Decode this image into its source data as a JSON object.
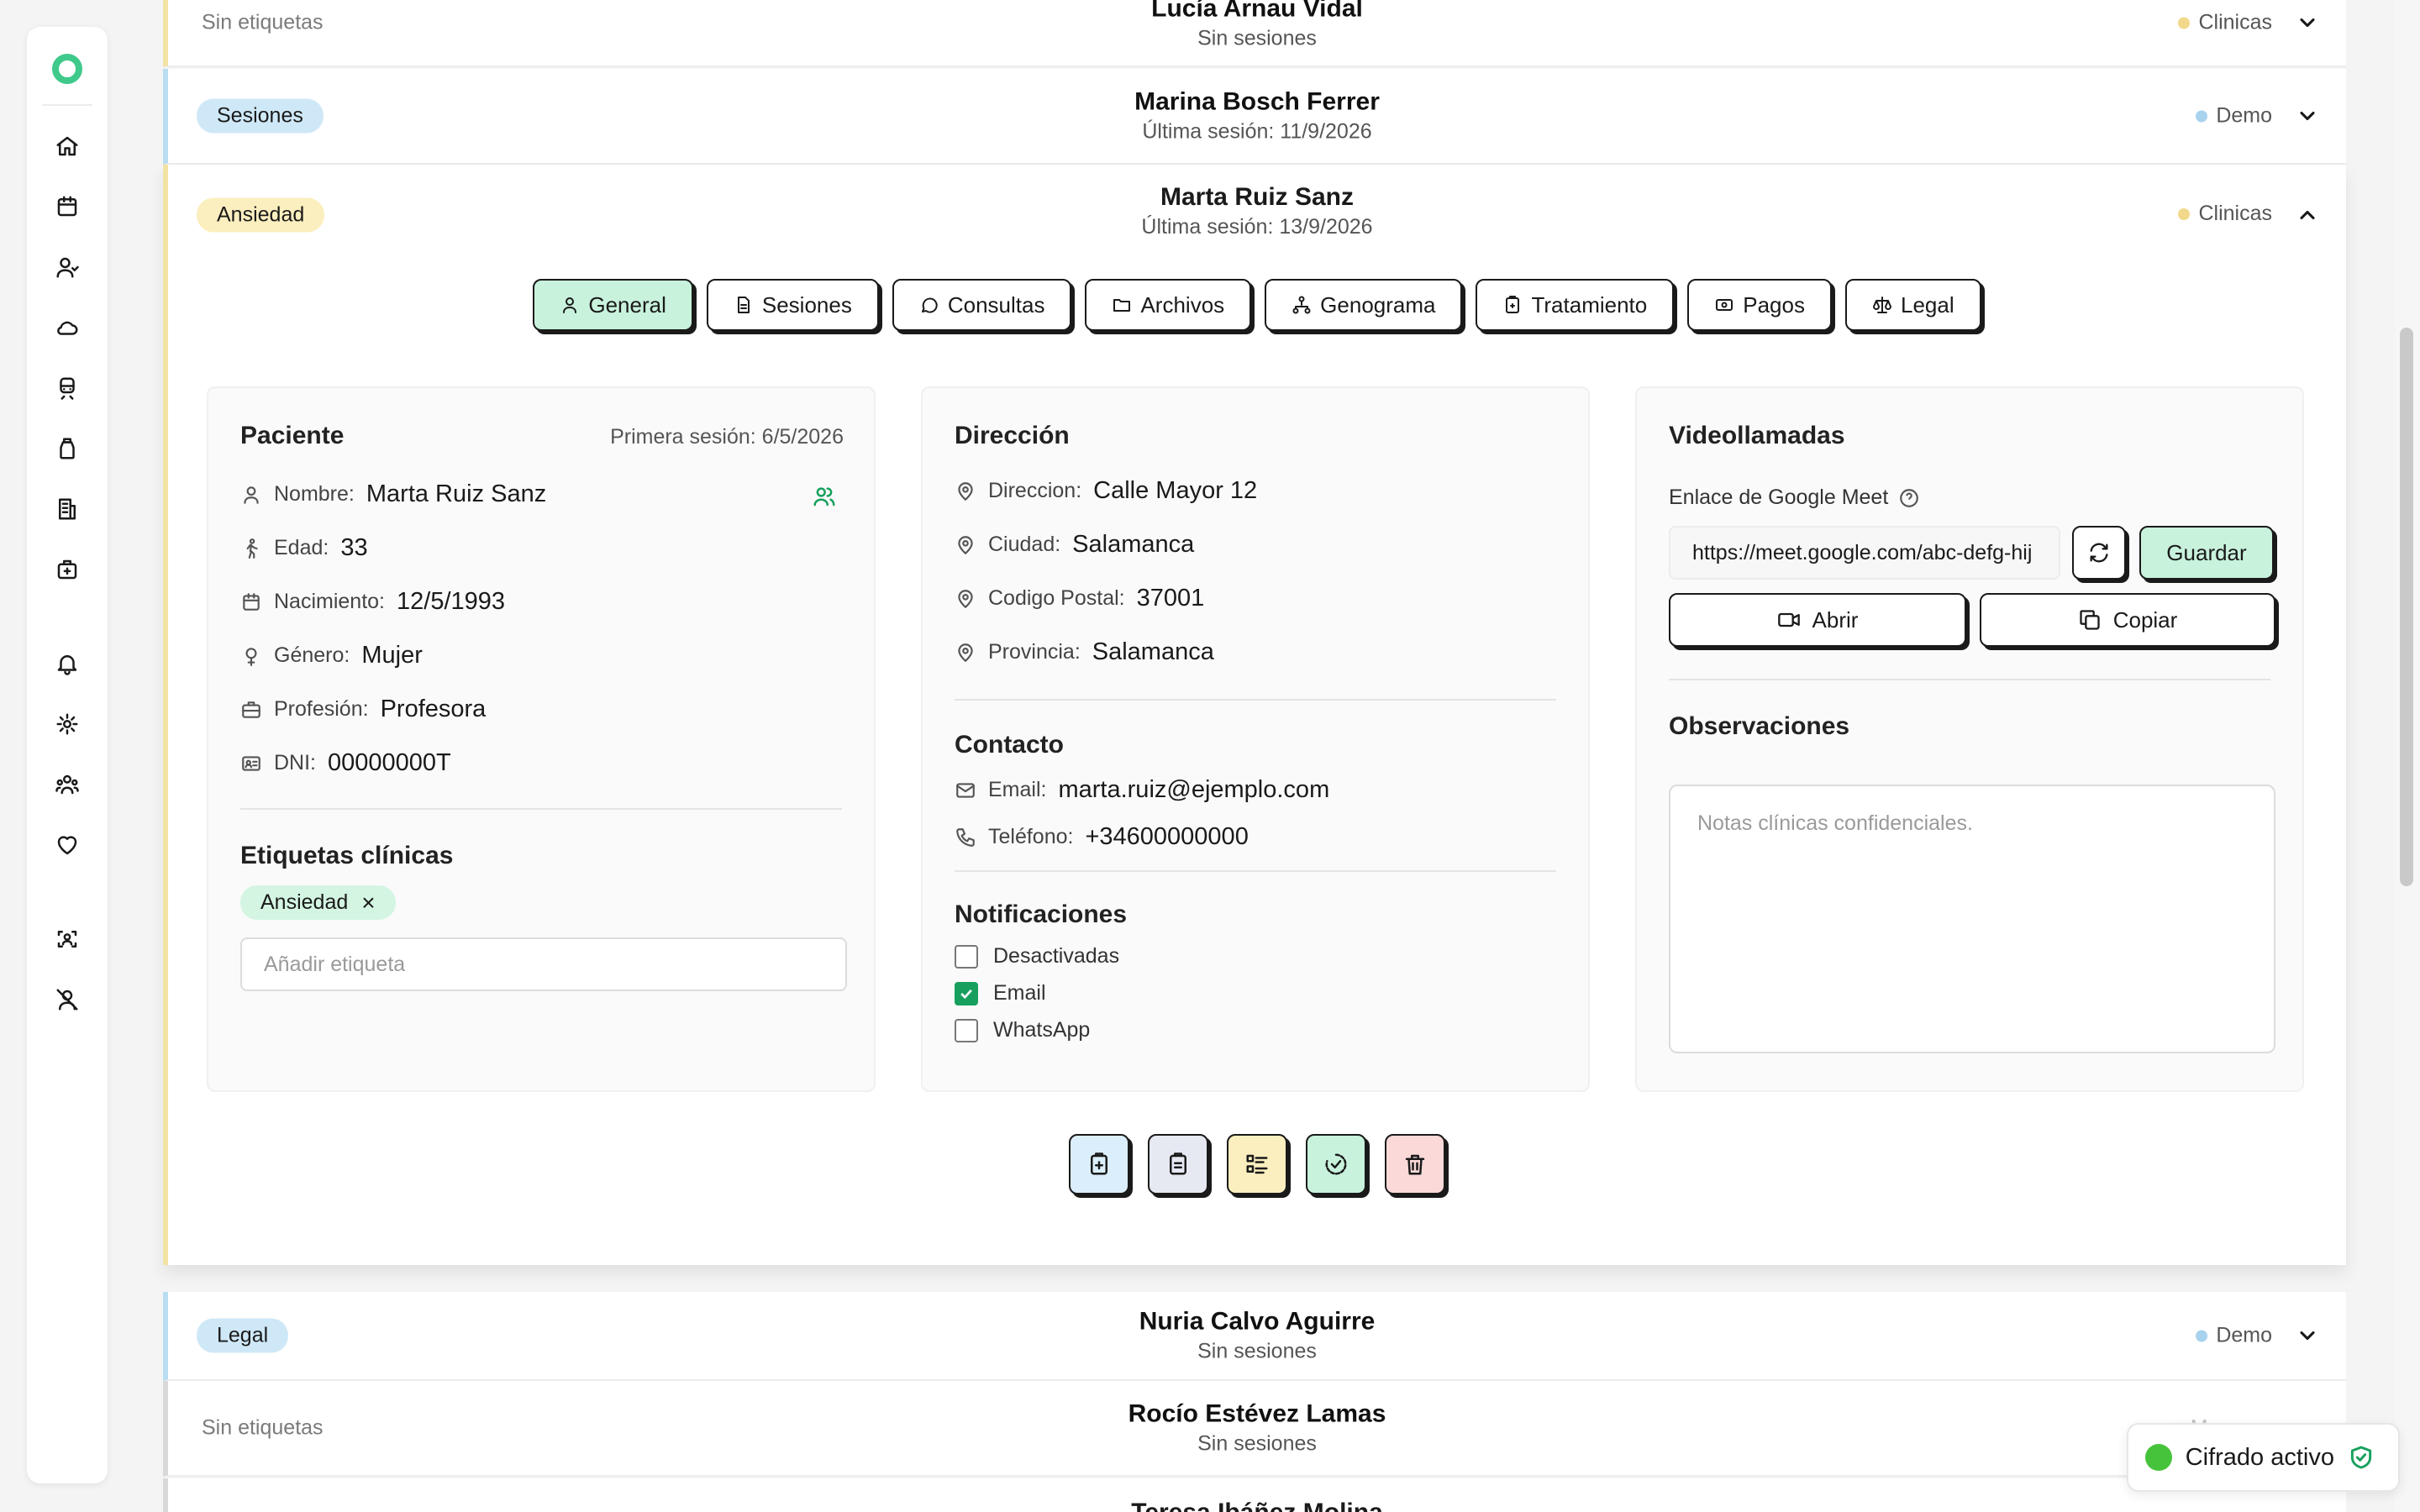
{
  "sidebar": {
    "items": [
      {
        "icon": "home-icon"
      },
      {
        "icon": "calendar-icon"
      },
      {
        "icon": "patient-icon"
      },
      {
        "icon": "cloud-icon"
      },
      {
        "icon": "train-icon"
      },
      {
        "icon": "bottle-icon"
      },
      {
        "icon": "building-icon"
      },
      {
        "icon": "medical-bag-icon"
      },
      {
        "icon": "bell-icon"
      },
      {
        "icon": "gear-icon"
      },
      {
        "icon": "team-icon"
      },
      {
        "icon": "heart-icon"
      },
      {
        "icon": "face-scan-icon"
      },
      {
        "icon": "user-off-icon"
      }
    ]
  },
  "rows": {
    "r1": {
      "tag": "Sin etiquetas",
      "name": "Lucía Arnau Vidal",
      "sub": "Sin sesiones",
      "kind": "Clinicas"
    },
    "r2": {
      "tag": "Sesiones",
      "name": "Marina Bosch Ferrer",
      "sub": "Última sesión: 11/9/2026",
      "kind": "Demo"
    },
    "r3": {
      "tag": "Ansiedad",
      "name": "Marta Ruiz Sanz",
      "sub": "Última sesión: 13/9/2026",
      "kind": "Clinicas"
    },
    "r4": {
      "tag": "Legal",
      "name": "Nuria Calvo Aguirre",
      "sub": "Sin sesiones",
      "kind": "Demo"
    },
    "r5": {
      "tag": "Sin etiquetas",
      "name": "Rocío Estévez Lamas",
      "sub": "Sin sesiones",
      "kind": "Menores"
    },
    "r6": {
      "name": "Teresa Ibáñez Molina"
    }
  },
  "tabs": {
    "general": "General",
    "sesiones": "Sesiones",
    "consultas": "Consultas",
    "archivos": "Archivos",
    "genograma": "Genograma",
    "tratamiento": "Tratamiento",
    "pagos": "Pagos",
    "legal": "Legal"
  },
  "patient": {
    "title": "Paciente",
    "first_session": "Primera sesión: 6/5/2026",
    "name_label": "Nombre:",
    "name": "Marta Ruiz Sanz",
    "age_label": "Edad:",
    "age": "33",
    "birth_label": "Nacimiento:",
    "birth": "12/5/1993",
    "gender_label": "Género:",
    "gender": "Mujer",
    "job_label": "Profesión:",
    "job": "Profesora",
    "dni_label": "DNI:",
    "dni": "00000000T",
    "tags_title": "Etiquetas clínicas",
    "tag": "Ansiedad",
    "tag_placeholder": "Añadir etiqueta"
  },
  "address": {
    "title": "Dirección",
    "street_label": "Direccion:",
    "street": "Calle Mayor 12",
    "city_label": "Ciudad:",
    "city": "Salamanca",
    "zip_label": "Codigo Postal:",
    "zip": "37001",
    "province_label": "Provincia:",
    "province": "Salamanca",
    "contact_title": "Contacto",
    "email_label": "Email:",
    "email": "marta.ruiz@ejemplo.com",
    "phone_label": "Teléfono:",
    "phone": "+34600000000",
    "notif_title": "Notificaciones",
    "notif": [
      {
        "label": "Desactivadas",
        "checked": false
      },
      {
        "label": "Email",
        "checked": true
      },
      {
        "label": "WhatsApp",
        "checked": false
      }
    ]
  },
  "video": {
    "title": "Videollamadas",
    "meet_label": "Enlace de Google Meet",
    "meet_url": "https://meet.google.com/abc-defg-hij",
    "save": "Guardar",
    "open": "Abrir",
    "copy": "Copiar",
    "obs_title": "Observaciones",
    "obs_placeholder": "Notas clínicas confidenciales."
  },
  "toast": {
    "label": "Cifrado activo"
  },
  "colors": {
    "accent": "#3fc98a",
    "active_tab": "#c8f2dc",
    "yellow_tag": "#fcefbf",
    "blue_tag": "#cfe8f7"
  }
}
